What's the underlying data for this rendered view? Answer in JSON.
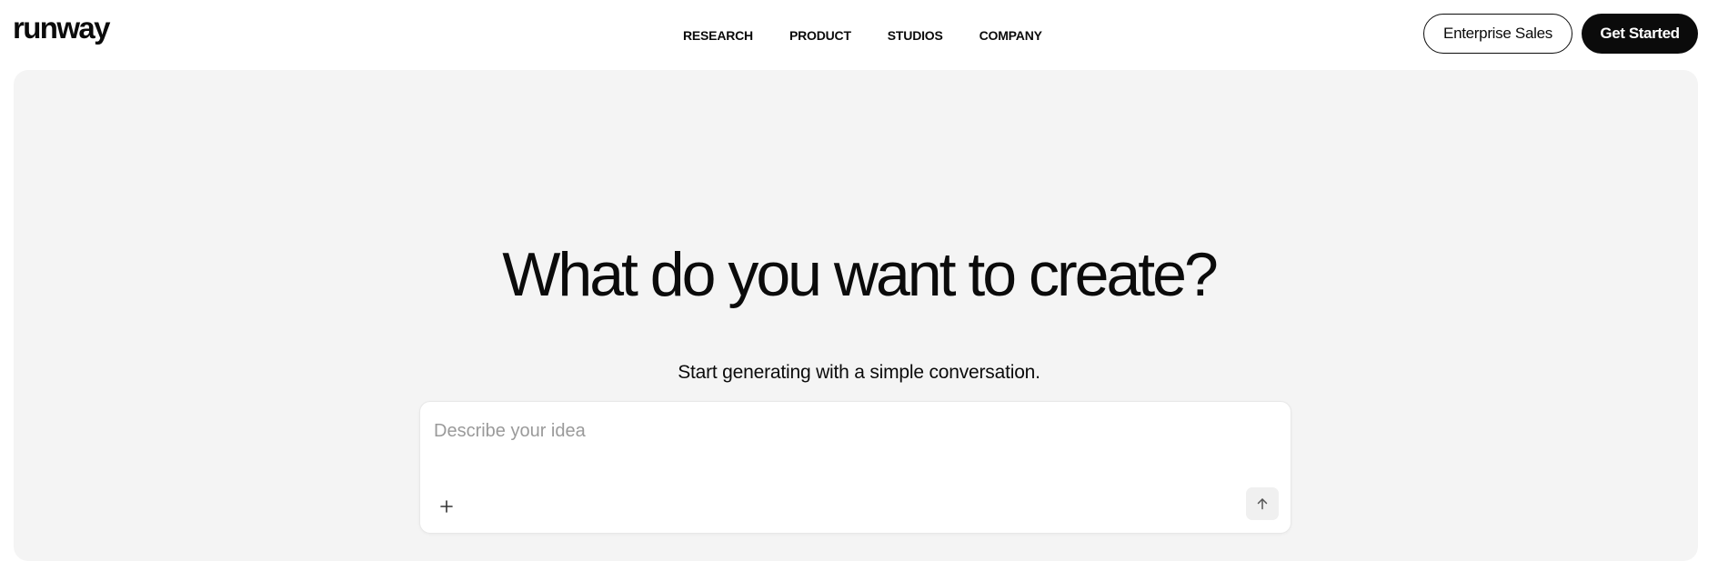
{
  "brand": {
    "logo_text": "runway"
  },
  "nav": {
    "items": [
      {
        "label": "RESEARCH"
      },
      {
        "label": "PRODUCT"
      },
      {
        "label": "STUDIOS"
      },
      {
        "label": "COMPANY"
      }
    ]
  },
  "header_actions": {
    "enterprise_label": "Enterprise Sales",
    "get_started_label": "Get Started"
  },
  "hero": {
    "title": "What do you want to create?",
    "subtitle": "Start generating with a simple conversation.",
    "prompt": {
      "placeholder": "Describe your idea",
      "value": "",
      "add_icon": "plus-icon",
      "send_icon": "arrow-up-icon"
    }
  },
  "colors": {
    "text": "#0b0b0b",
    "panel_bg": "#f4f4f4",
    "placeholder": "#9a9a9a",
    "button_dark": "#0b0b0b",
    "send_bg": "#f0f0f0"
  }
}
